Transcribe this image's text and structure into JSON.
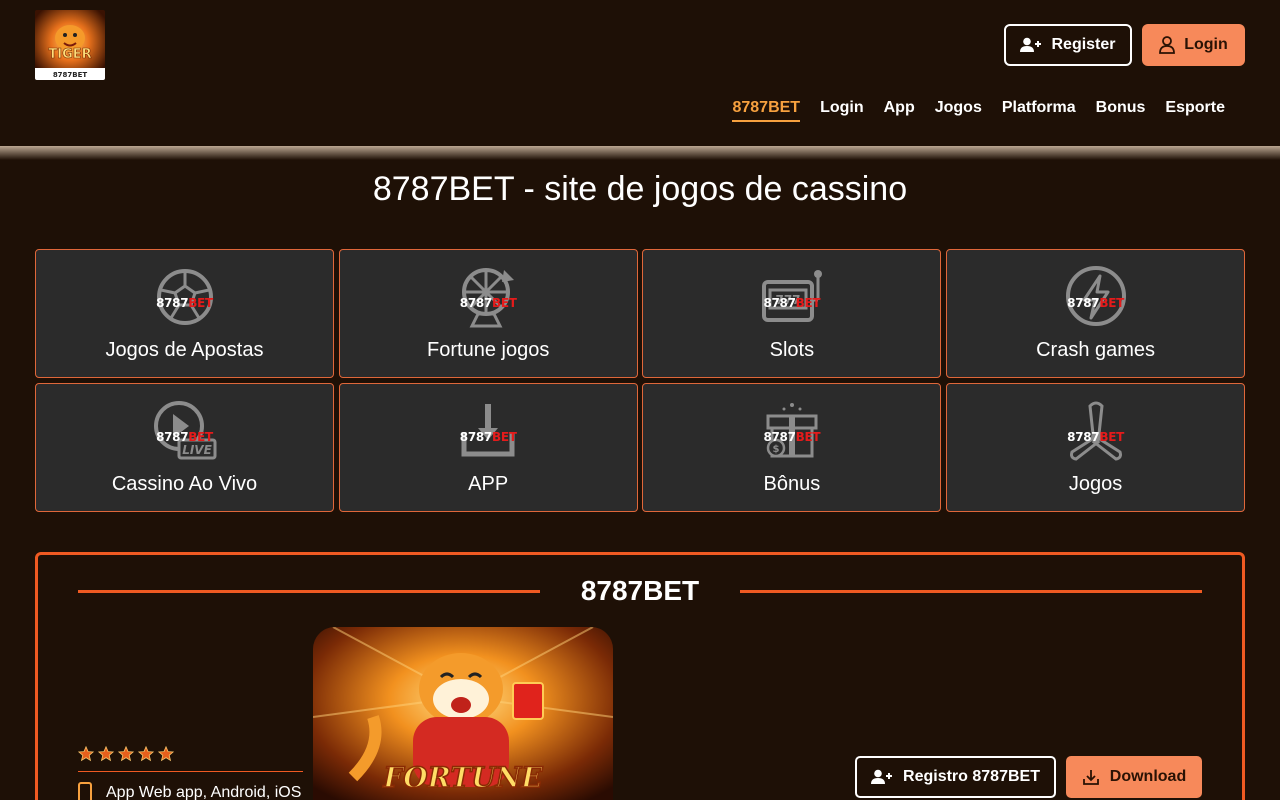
{
  "header": {
    "logo_text": "8787BET",
    "register_label": "Register",
    "login_label": "Login",
    "nav": [
      {
        "label": "8787BET",
        "active": true
      },
      {
        "label": "Login"
      },
      {
        "label": "App"
      },
      {
        "label": "Jogos"
      },
      {
        "label": "Platforma"
      },
      {
        "label": "Bonus"
      },
      {
        "label": "Esporte"
      }
    ]
  },
  "page_title": "8787BET - site de jogos de cassino",
  "watermark": {
    "left": "8787",
    "right": "BET"
  },
  "categories": [
    {
      "label": "Jogos de Apostas",
      "icon": "soccer-ball-icon"
    },
    {
      "label": "Fortune jogos",
      "icon": "fortune-wheel-icon"
    },
    {
      "label": "Slots",
      "icon": "slot-machine-icon"
    },
    {
      "label": "Crash games",
      "icon": "lightning-icon"
    },
    {
      "label": "Cassino Ao Vivo",
      "icon": "live-play-icon"
    },
    {
      "label": "APP",
      "icon": "download-tray-icon"
    },
    {
      "label": "Bônus",
      "icon": "gift-icon"
    },
    {
      "label": "Jogos",
      "icon": "propeller-icon"
    }
  ],
  "section": {
    "title": "8787BET",
    "rating": 5,
    "app_text": "App Web app, Android, iOS",
    "register_label": "Registro 8787BET",
    "download_label": "Download"
  },
  "colors": {
    "background": "#1e1006",
    "accent": "#f05a22",
    "button_orange": "#f7895a",
    "active_nav": "#f7a13f",
    "tile": "#2b2b2b"
  }
}
